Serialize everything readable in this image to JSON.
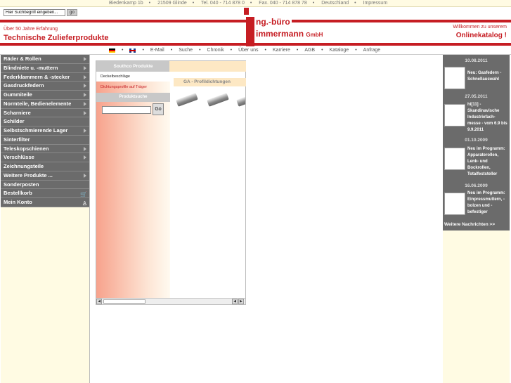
{
  "header": {
    "address": [
      "Biedenkamp 1b",
      "21509 Glinde",
      "Tel. 040 - 714 878 0",
      "Fax. 040 - 714 878 78",
      "Deutschland",
      "Impressum"
    ],
    "search_placeholder": "Hier Suchbegriff eingeben...",
    "search_button": "go",
    "tagline": "Über 50 Jahre Erfahrung",
    "slogan": "Technische Zulieferprodukte",
    "logo_line1": "ng.-büro",
    "logo_line2": "immermann",
    "logo_suffix": "GmbH",
    "welcome": "Willkommen zu unserem",
    "catalog": "Onlinekatalog !"
  },
  "nav": [
    "E-Mail",
    "Suche",
    "Chronik",
    "Über uns",
    "Karriere",
    "AGB",
    "Kataloge",
    "Anfrage"
  ],
  "sidebar": {
    "items": [
      {
        "label": "Räder & Rollen",
        "arrow": true
      },
      {
        "label": "Blindniete u. -muttern",
        "arrow": true
      },
      {
        "label": "Federklammern & -stecker",
        "arrow": true
      },
      {
        "label": "Gasdruckfedern",
        "arrow": true
      },
      {
        "label": "Gummiteile",
        "arrow": true
      },
      {
        "label": "Normteile, Bedienelemente",
        "arrow": true
      },
      {
        "label": "Scharniere",
        "arrow": true
      },
      {
        "label": "Schilder",
        "arrow": false
      },
      {
        "label": "Selbstschmierende Lager",
        "arrow": true
      },
      {
        "label": "Sinterfilter",
        "arrow": false
      },
      {
        "label": "Teleskopschienen",
        "arrow": true
      },
      {
        "label": "Verschlüsse",
        "arrow": true
      },
      {
        "label": "Zeichnungsteile",
        "arrow": false
      },
      {
        "label": "Weitere Produkte ...",
        "arrow": true
      },
      {
        "label": "Sonderposten",
        "arrow": false
      },
      {
        "label": "Bestellkorb",
        "icon": "cart-icon"
      },
      {
        "label": "Mein Konto",
        "icon": "user-icon"
      }
    ]
  },
  "panel": {
    "tab_label": "Southco Produkte",
    "sub1": "Deckelbeschläge",
    "sub2": "Dichtungsprofile auf Träger",
    "product_search": "Produktsuche",
    "go": "Go",
    "category": "GA - Profildichtungen"
  },
  "news": {
    "items": [
      {
        "date": "10.08.2011",
        "text": "Neu: Gasfedern - Schnellauswahl"
      },
      {
        "date": "27.05.2011",
        "text": "hi[11] - Skandinavische Industriefach-messe - vom 6.9 bis 9.9.2011"
      },
      {
        "date": "01.10.2009",
        "text": "Neu im Programm: Apparaterollen, Lenk- und Bockrollen, Totalfeststeller"
      },
      {
        "date": "16.06.2009",
        "text": "Neu im Programm: Einpressmuttern, -bolzen und -befestiger"
      }
    ],
    "more": "Weitere Nachrichten >>"
  }
}
